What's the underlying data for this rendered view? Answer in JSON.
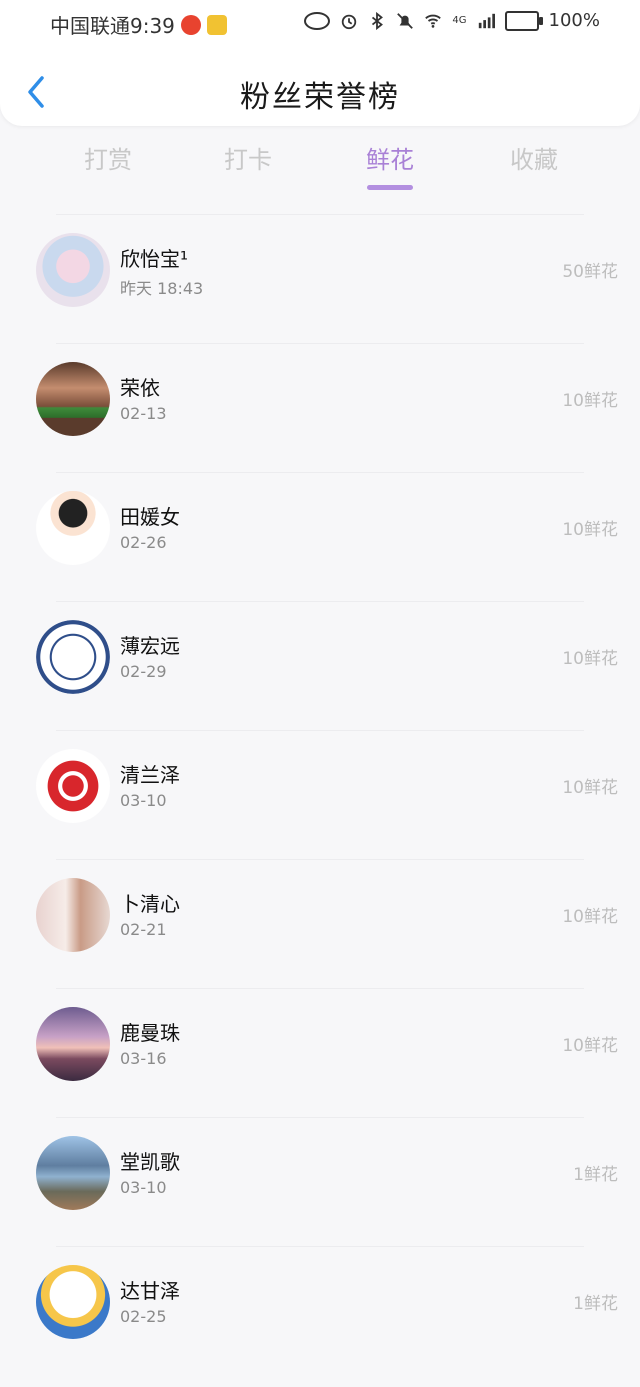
{
  "status_bar": {
    "carrier_time": "中国联通9:39",
    "battery": "100%",
    "network": "4G"
  },
  "header": {
    "title": "粉丝荣誉榜"
  },
  "tabs": [
    {
      "label": "打赏",
      "active": false
    },
    {
      "label": "打卡",
      "active": false
    },
    {
      "label": "鲜花",
      "active": true
    },
    {
      "label": "收藏",
      "active": false
    }
  ],
  "colors": {
    "accent": "#b38fe0",
    "inactive_tab": "#c8c8c8",
    "amount": "#bdbdbd"
  },
  "rows": [
    {
      "name": "欣怡宝¹",
      "time": "昨天 18:43",
      "amount": "50鲜花",
      "avatar": "anime-girl-avatar"
    },
    {
      "name": "荣依",
      "time": "02-13",
      "amount": "10鲜花",
      "avatar": "woman-photo-avatar"
    },
    {
      "name": "田媛女",
      "time": "02-26",
      "amount": "10鲜花",
      "avatar": "cartoon-doll-avatar"
    },
    {
      "name": "薄宏远",
      "time": "02-29",
      "amount": "10鲜花",
      "avatar": "emblem-avatar"
    },
    {
      "name": "清兰泽",
      "time": "03-10",
      "amount": "10鲜花",
      "avatar": "papercut-avatar"
    },
    {
      "name": "卜清心",
      "time": "02-21",
      "amount": "10鲜花",
      "avatar": "girl-photo-avatar"
    },
    {
      "name": "鹿曼珠",
      "time": "03-16",
      "amount": "10鲜花",
      "avatar": "sunset-avatar"
    },
    {
      "name": "堂凯歌",
      "time": "03-10",
      "amount": "1鲜花",
      "avatar": "lake-avatar"
    },
    {
      "name": "达甘泽",
      "time": "02-25",
      "amount": "1鲜花",
      "avatar": "hello-kitty-avatar"
    }
  ]
}
